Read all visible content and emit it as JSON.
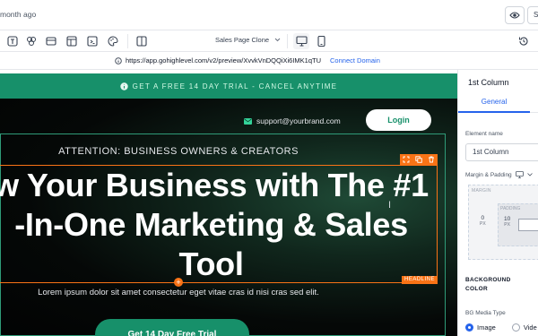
{
  "topbar": {
    "saved_text": "month ago",
    "save_label": "S"
  },
  "toolbar": {
    "page_name": "Sales Page Clone"
  },
  "urlbar": {
    "url": "https://app.gohighlevel.com/v2/preview/XvvkVnDQQiXi6IMK1qTU",
    "connect_label": "Connect Domain"
  },
  "page": {
    "promo_text": "GET A FREE 14 DAY TRIAL - CANCEL ANYTIME",
    "email": "support@yourbrand.com",
    "login_label": "Login",
    "attention": "ATTENTION: BUSINESS OWNERS & CREATORS",
    "headline_line1": "w Your Business with The #1",
    "headline_line2": "-In-One Marketing & Sales",
    "headline_line3": "Tool",
    "headline_tag": "HEADLINE",
    "lorem": "Lorem ipsum dolor sit amet consectetur eget vitae cras id nisi cras sed elit.",
    "trial_label": "Get 14 Day Free Trial"
  },
  "panel": {
    "title": "1st Column",
    "tab_general": "General",
    "element_name_label": "Element name",
    "element_name_value": "1st Column",
    "margin_padding_label": "Margin & Padding",
    "margin_label": "MARGIN",
    "margin_value": "0",
    "padding_label": "PADDING",
    "padding_value": "10",
    "unit": "PX",
    "background_color_label_1": "BACKGROUND",
    "background_color_label_2": "COLOR",
    "bg_media_type_label": "BG Media Type",
    "option_image": "Image",
    "option_video": "Vide"
  },
  "colors": {
    "brand_green": "#17906a",
    "selection_orange": "#f97316",
    "link_blue": "#2563eb"
  }
}
